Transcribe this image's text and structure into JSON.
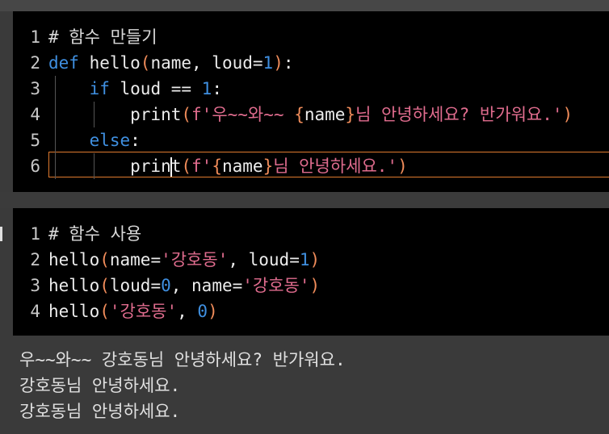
{
  "cell1": {
    "lines": [
      {
        "n": "1",
        "t": [
          [
            "cmt",
            "# 함수 만들기"
          ]
        ]
      },
      {
        "n": "2",
        "t": [
          [
            "kw",
            "def "
          ],
          [
            "plain",
            "hello"
          ],
          [
            "paren",
            "("
          ],
          [
            "plain",
            "name, loud="
          ],
          [
            "num",
            "1"
          ],
          [
            "paren",
            ")"
          ],
          [
            "plain",
            ":"
          ]
        ]
      },
      {
        "n": "3",
        "t": [
          [
            "plain",
            "    "
          ],
          [
            "kw",
            "if "
          ],
          [
            "plain",
            "loud == "
          ],
          [
            "num",
            "1"
          ],
          [
            "plain",
            ":"
          ]
        ]
      },
      {
        "n": "4",
        "t": [
          [
            "plain",
            "        print"
          ],
          [
            "paren",
            "("
          ],
          [
            "str",
            "f'우~~와~~ "
          ],
          [
            "brace",
            "{"
          ],
          [
            "plain",
            "name"
          ],
          [
            "brace",
            "}"
          ],
          [
            "str",
            "님 안녕하세요? 반가워요.'"
          ],
          [
            "paren",
            ")"
          ]
        ]
      },
      {
        "n": "5",
        "t": [
          [
            "plain",
            "    "
          ],
          [
            "kw",
            "else"
          ],
          [
            "plain",
            ":"
          ]
        ]
      },
      {
        "n": "6",
        "t": [
          [
            "plain",
            "        print"
          ],
          [
            "paren",
            "("
          ],
          [
            "str",
            "f'"
          ],
          [
            "brace",
            "{"
          ],
          [
            "plain",
            "name"
          ],
          [
            "brace",
            "}"
          ],
          [
            "str",
            "님 안녕하세요.'"
          ],
          [
            "paren",
            ")"
          ]
        ]
      }
    ]
  },
  "cell2": {
    "lines": [
      {
        "n": "1",
        "t": [
          [
            "cmt",
            "# 함수 사용"
          ]
        ]
      },
      {
        "n": "2",
        "t": [
          [
            "plain",
            "hello"
          ],
          [
            "paren",
            "("
          ],
          [
            "plain",
            "name="
          ],
          [
            "str",
            "'강호동'"
          ],
          [
            "plain",
            ", loud="
          ],
          [
            "num",
            "1"
          ],
          [
            "paren",
            ")"
          ]
        ]
      },
      {
        "n": "3",
        "t": [
          [
            "plain",
            "hello"
          ],
          [
            "paren",
            "("
          ],
          [
            "plain",
            "loud="
          ],
          [
            "num",
            "0"
          ],
          [
            "plain",
            ", name="
          ],
          [
            "str",
            "'강호동'"
          ],
          [
            "paren",
            ")"
          ]
        ]
      },
      {
        "n": "4",
        "t": [
          [
            "plain",
            "hello"
          ],
          [
            "paren",
            "("
          ],
          [
            "str",
            "'강호동'"
          ],
          [
            "plain",
            ", "
          ],
          [
            "num",
            "0"
          ],
          [
            "paren",
            ")"
          ]
        ]
      }
    ]
  },
  "output": {
    "lines": [
      "우~~와~~ 강호동님 안녕하세요? 반가워요.",
      "강호동님 안녕하세요.",
      "강호동님 안녕하세요."
    ]
  },
  "colors": {
    "keyword": "#3f8fe0",
    "string": "#e06c8e",
    "bracket": "#f08c5a",
    "active_line_border": "#e07a2e"
  }
}
